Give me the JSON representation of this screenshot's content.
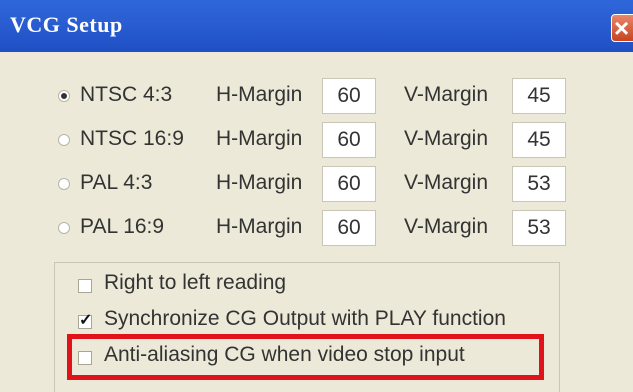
{
  "window": {
    "title": "VCG Setup"
  },
  "modes": [
    {
      "label": "NTSC 4:3",
      "selected": true,
      "h_label": "H-Margin",
      "h_value": "60",
      "v_label": "V-Margin",
      "v_value": "45"
    },
    {
      "label": "NTSC 16:9",
      "selected": false,
      "h_label": "H-Margin",
      "h_value": "60",
      "v_label": "V-Margin",
      "v_value": "45"
    },
    {
      "label": "PAL 4:3",
      "selected": false,
      "h_label": "H-Margin",
      "h_value": "60",
      "v_label": "V-Margin",
      "v_value": "53"
    },
    {
      "label": "PAL 16:9",
      "selected": false,
      "h_label": "H-Margin",
      "h_value": "60",
      "v_label": "V-Margin",
      "v_value": "53"
    }
  ],
  "options": [
    {
      "label": "Right to left reading",
      "checked": false
    },
    {
      "label": "Synchronize CG Output with PLAY function",
      "checked": true
    },
    {
      "label": "Anti-aliasing CG when video stop input",
      "checked": false,
      "highlighted": true
    }
  ],
  "colors": {
    "titlebar": "#2a5ed2",
    "dialog": "#ece9d8",
    "highlight": "#e0131b"
  }
}
